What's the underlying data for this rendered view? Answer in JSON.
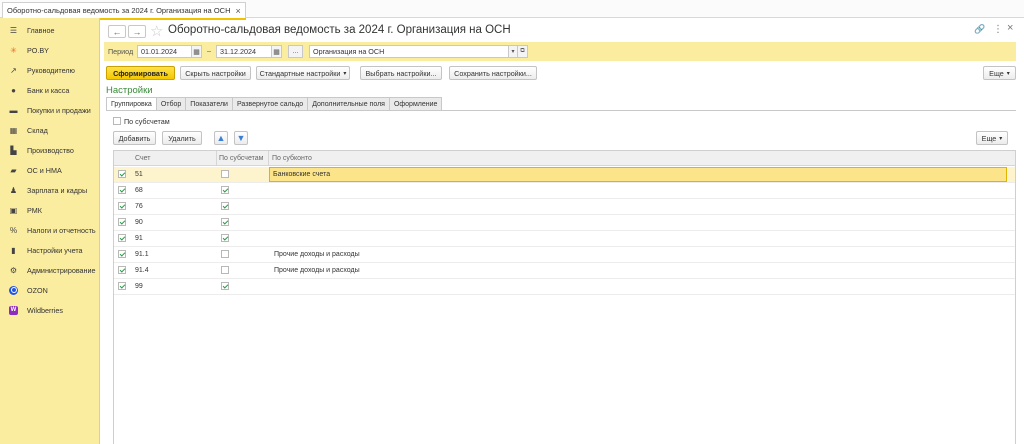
{
  "window": {
    "tab_title": "Оборотно-сальдовая ведомость за 2024 г. Организация на ОСН",
    "tab_close": "×"
  },
  "sidebar": {
    "items": [
      {
        "label": "Главное",
        "icon": "menu-icon"
      },
      {
        "label": "PO.BY",
        "icon": "sparkle-icon"
      },
      {
        "label": "Руководителю",
        "icon": "trend-icon"
      },
      {
        "label": "Банк и касса",
        "icon": "coin-icon"
      },
      {
        "label": "Покупки и продажи",
        "icon": "cart-icon"
      },
      {
        "label": "Склад",
        "icon": "warehouse-icon"
      },
      {
        "label": "Производство",
        "icon": "factory-icon"
      },
      {
        "label": "ОС и НМА",
        "icon": "truck-icon"
      },
      {
        "label": "Зарплата и кадры",
        "icon": "person-icon"
      },
      {
        "label": "РМК",
        "icon": "register-icon"
      },
      {
        "label": "Налоги и отчетность",
        "icon": "percent-icon"
      },
      {
        "label": "Настройки учета",
        "icon": "book-icon"
      },
      {
        "label": "Администрирование",
        "icon": "gear-icon"
      },
      {
        "label": "OZON",
        "icon": "ozon-icon"
      },
      {
        "label": "Wildberries",
        "icon": "wildberries-icon"
      }
    ]
  },
  "header": {
    "title": "Оборотно-сальдовая ведомость за 2024 г. Организация на ОСН",
    "back_glyph": "←",
    "forward_glyph": "→",
    "link_glyph": "🔗",
    "more_glyph": "⋮",
    "close_glyph": "×"
  },
  "period": {
    "label": "Период",
    "date_from": "01.01.2024",
    "dash": "–",
    "date_to": "31.12.2024",
    "ellipsis": "...",
    "organization": "Организация на ОСН"
  },
  "toolbar": {
    "generate": "Сформировать",
    "hide_settings": "Скрыть настройки",
    "standard_settings": "Стандартные настройки",
    "choose_settings": "Выбрать настройки...",
    "save_settings": "Сохранить настройки...",
    "more": "Еще"
  },
  "settings": {
    "title": "Настройки",
    "tabs": [
      "Группировка",
      "Отбор",
      "Показатели",
      "Развернутое сальдо",
      "Дополнительные поля",
      "Оформление"
    ],
    "by_subaccounts_label": "По субсчетам",
    "add": "Добавить",
    "delete": "Удалить",
    "up_glyph": "🡅",
    "down_glyph": "🡇",
    "more": "Еще"
  },
  "table": {
    "columns": [
      "Счет",
      "По субсчетам",
      "По субконто"
    ],
    "rows": [
      {
        "enabled": true,
        "account": "51",
        "by_sub": false,
        "subconto": "Банковские счета",
        "selected": true
      },
      {
        "enabled": true,
        "account": "68",
        "by_sub": true,
        "subconto": ""
      },
      {
        "enabled": true,
        "account": "76",
        "by_sub": true,
        "subconto": ""
      },
      {
        "enabled": true,
        "account": "90",
        "by_sub": true,
        "subconto": ""
      },
      {
        "enabled": true,
        "account": "91",
        "by_sub": true,
        "subconto": ""
      },
      {
        "enabled": true,
        "account": "91.1",
        "by_sub": false,
        "subconto": "Прочие доходы и расходы"
      },
      {
        "enabled": true,
        "account": "91.4",
        "by_sub": false,
        "subconto": "Прочие доходы и расходы"
      },
      {
        "enabled": true,
        "account": "99",
        "by_sub": true,
        "subconto": ""
      }
    ]
  },
  "colors": {
    "accent_yellow": "#f4c800",
    "sidebar_bg": "#fbeda0",
    "check_green": "#2e9a48",
    "title_green": "#3b8a3b"
  }
}
